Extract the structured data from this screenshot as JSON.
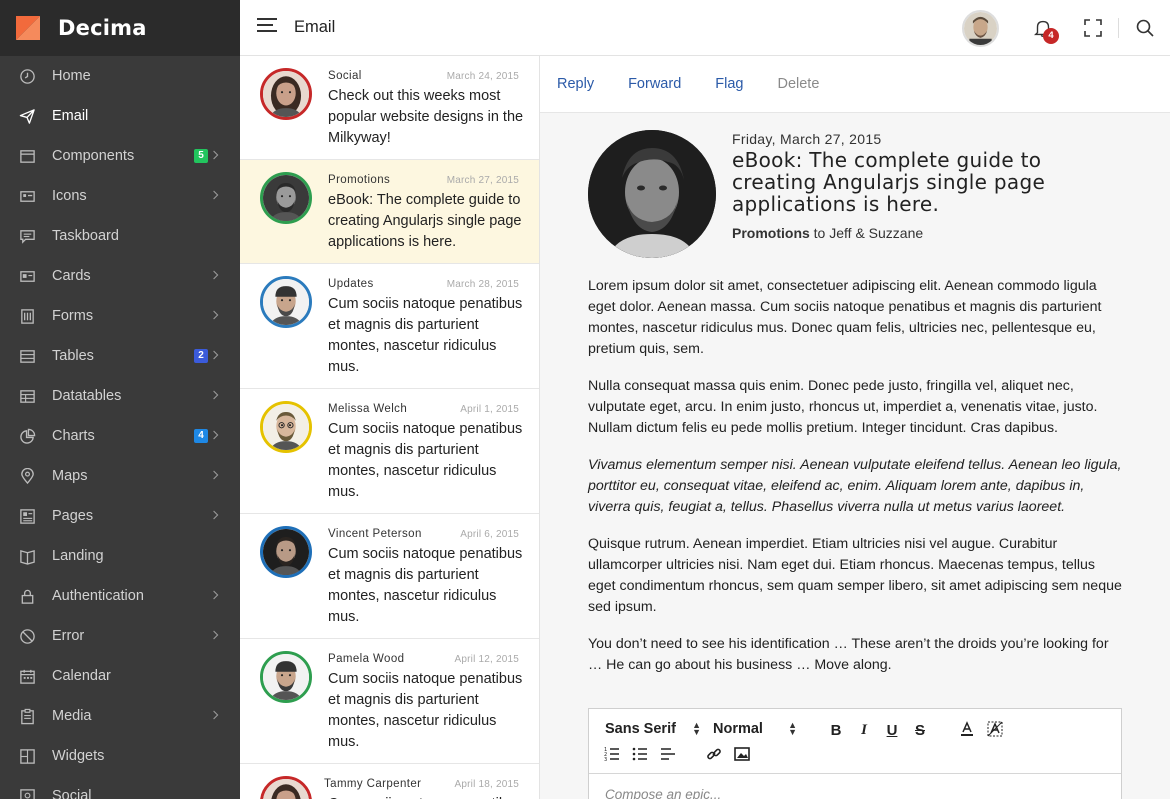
{
  "brand": {
    "name": "Decima",
    "logo_colors": [
      "#f26a3c",
      "#f58a5c"
    ]
  },
  "sidebar": {
    "items": [
      {
        "label": "Home",
        "icon": "clock-icon",
        "active": false
      },
      {
        "label": "Email",
        "icon": "paper-plane-icon",
        "active": true
      },
      {
        "label": "Components",
        "icon": "window-icon",
        "badge": "5",
        "badge_color": "#22c55e",
        "chevron": true
      },
      {
        "label": "Icons",
        "icon": "icons-grid-icon",
        "chevron": true
      },
      {
        "label": "Taskboard",
        "icon": "chat-icon"
      },
      {
        "label": "Cards",
        "icon": "cards-icon",
        "chevron": true
      },
      {
        "label": "Forms",
        "icon": "forms-icon",
        "chevron": true
      },
      {
        "label": "Tables",
        "icon": "table-icon",
        "badge": "2",
        "badge_color": "#3b5bdb",
        "chevron": true
      },
      {
        "label": "Datatables",
        "icon": "datatable-icon",
        "chevron": true
      },
      {
        "label": "Charts",
        "icon": "pie-chart-icon",
        "badge": "4",
        "badge_color": "#1e88e5",
        "chevron": true
      },
      {
        "label": "Maps",
        "icon": "map-pin-icon",
        "chevron": true
      },
      {
        "label": "Pages",
        "icon": "pages-icon",
        "chevron": true
      },
      {
        "label": "Landing",
        "icon": "book-icon"
      },
      {
        "label": "Authentication",
        "icon": "lock-icon",
        "chevron": true
      },
      {
        "label": "Error",
        "icon": "ban-icon",
        "chevron": true
      },
      {
        "label": "Calendar",
        "icon": "calendar-icon"
      },
      {
        "label": "Media",
        "icon": "clipboard-icon",
        "chevron": true
      },
      {
        "label": "Widgets",
        "icon": "widgets-icon"
      },
      {
        "label": "Social",
        "icon": "social-icon"
      }
    ]
  },
  "header": {
    "title": "Email",
    "notifications_count": "4"
  },
  "mail_list": [
    {
      "from": "Social",
      "date": "March 24, 2015",
      "subject": "Check out this weeks most popular website designs in the Milkyway!",
      "ring": "#c62828",
      "selected": false
    },
    {
      "from": "Promotions",
      "date": "March 27, 2015",
      "subject": "eBook: The complete guide to creating Angularjs single page applications is here.",
      "ring": "#2e9e4f",
      "selected": true
    },
    {
      "from": "Updates",
      "date": "March 28, 2015",
      "subject": "Cum sociis natoque penatibus et magnis dis parturient montes, nascetur ridiculus mus.",
      "ring": "#2b7bbd",
      "selected": false
    },
    {
      "from": "Melissa Welch",
      "date": "April 1, 2015",
      "subject": "Cum sociis natoque penatibus et magnis dis parturient montes, nascetur ridiculus mus.",
      "ring": "#e5c200",
      "selected": false
    },
    {
      "from": "Vincent Peterson",
      "date": "April 6, 2015",
      "subject": "Cum sociis natoque penatibus et magnis dis parturient montes, nascetur ridiculus mus.",
      "ring": "#1e6fb8",
      "selected": false
    },
    {
      "from": "Pamela Wood",
      "date": "April 12, 2015",
      "subject": "Cum sociis natoque penatibus et magnis dis parturient montes, nascetur ridiculus mus.",
      "ring": "#2e9e4f",
      "selected": false
    },
    {
      "from": "Tammy Carpenter",
      "date": "April 18, 2015",
      "subject": "Cum sociis natoque penatibus et magnis dis",
      "ring": "#c62828",
      "selected": false
    }
  ],
  "reader": {
    "actions": {
      "reply": "Reply",
      "forward": "Forward",
      "flag": "Flag",
      "delete": "Delete"
    },
    "date": "Friday, March 27, 2015",
    "subject": "eBook: The complete guide to creating Angularjs single page applications is here.",
    "sender": "Promotions",
    "recipients": "to Jeff & Suzzane",
    "body": [
      "Lorem ipsum dolor sit amet, consectetuer adipiscing elit. Aenean commodo ligula eget dolor. Aenean massa. Cum sociis natoque penatibus et magnis dis parturient montes, nascetur ridiculus mus. Donec quam felis, ultricies nec, pellentesque eu, pretium quis, sem.",
      "Nulla consequat massa quis enim. Donec pede justo, fringilla vel, aliquet nec, vulputate eget, arcu. In enim justo, rhoncus ut, imperdiet a, venenatis vitae, justo. Nullam dictum felis eu pede mollis pretium. Integer tincidunt. Cras dapibus.",
      "Vivamus elementum semper nisi. Aenean vulputate eleifend tellus. Aenean leo ligula, porttitor eu, consequat vitae, eleifend ac, enim. Aliquam lorem ante, dapibus in, viverra quis, feugiat a, tellus. Phasellus viverra nulla ut metus varius laoreet.",
      "Quisque rutrum. Aenean imperdiet. Etiam ultricies nisi vel augue. Curabitur ullamcorper ultricies nisi. Nam eget dui. Etiam rhoncus. Maecenas tempus, tellus eget condimentum rhoncus, sem quam semper libero, sit amet adipiscing sem neque sed ipsum.",
      "You don’t need to see his identification … These aren’t the droids you’re looking for … He can go about his business … Move along."
    ]
  },
  "editor": {
    "font": "Sans Serif",
    "size": "Normal",
    "placeholder": "Compose an epic..."
  }
}
